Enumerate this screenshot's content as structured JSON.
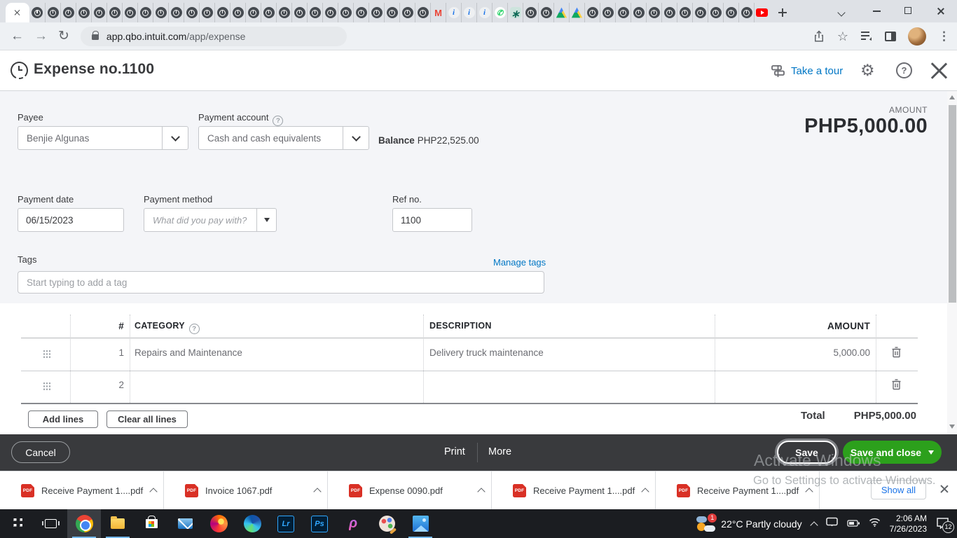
{
  "browser": {
    "url_host": "app.qbo.intuit.com",
    "url_path": "/app/expense",
    "favicons": [
      "qb",
      "qb",
      "qb",
      "qb",
      "qb",
      "qb",
      "qb",
      "qb",
      "qb",
      "qb",
      "qb",
      "qb",
      "qb",
      "qb",
      "qb",
      "qb",
      "qb",
      "qb",
      "qb",
      "qb",
      "qb",
      "qb",
      "qb",
      "qb",
      "qb",
      "qb",
      "gmail",
      "info",
      "info",
      "info",
      "whatsapp",
      "chatgpt",
      "qb",
      "qb",
      "drive",
      "drive",
      "qb",
      "qb",
      "qb",
      "qb",
      "qb",
      "qb",
      "qb",
      "qb",
      "qb",
      "qb",
      "qb",
      "youtube"
    ]
  },
  "header": {
    "title": "Expense no.1100",
    "tour_label": "Take a tour"
  },
  "form": {
    "payee": {
      "label": "Payee",
      "value": "Benjie Algunas"
    },
    "payment_account": {
      "label": "Payment account",
      "value": "Cash and cash equivalents"
    },
    "balance": {
      "label": "Balance",
      "value": "PHP22,525.00"
    },
    "amount": {
      "label": "AMOUNT",
      "value": "PHP5,000.00"
    },
    "payment_date": {
      "label": "Payment date",
      "value": "06/15/2023"
    },
    "payment_method": {
      "label": "Payment method",
      "placeholder": "What did you pay with?"
    },
    "ref_no": {
      "label": "Ref no.",
      "value": "1100"
    },
    "tags": {
      "label": "Tags",
      "manage_link": "Manage tags",
      "placeholder": "Start typing to add a tag"
    }
  },
  "table": {
    "headers": {
      "num": "#",
      "category": "CATEGORY",
      "description": "DESCRIPTION",
      "amount": "AMOUNT"
    },
    "rows": [
      {
        "num": "1",
        "category": "Repairs and Maintenance",
        "description": "Delivery truck maintenance",
        "amount": "5,000.00"
      },
      {
        "num": "2",
        "category": "",
        "description": "",
        "amount": ""
      }
    ],
    "add_lines_label": "Add lines",
    "clear_lines_label": "Clear all lines",
    "total_label": "Total",
    "total_value": "PHP5,000.00"
  },
  "footer": {
    "cancel": "Cancel",
    "print": "Print",
    "more": "More",
    "save": "Save",
    "save_and_close": "Save and close"
  },
  "downloads": {
    "items": [
      {
        "name": "Receive Payment 1....pdf"
      },
      {
        "name": "Invoice 1067.pdf"
      },
      {
        "name": "Expense 0090.pdf"
      },
      {
        "name": "Receive Payment 1....pdf"
      },
      {
        "name": "Receive Payment 1....pdf"
      }
    ],
    "show_all": "Show all"
  },
  "watermark": {
    "line1": "Activate Windows",
    "line2": "Go to Settings to activate Windows."
  },
  "taskbar": {
    "icons": [
      {
        "type": "start"
      },
      {
        "type": "taskview"
      },
      {
        "type": "chrome",
        "active": true,
        "open": true
      },
      {
        "type": "explorer",
        "open": true
      },
      {
        "type": "store"
      },
      {
        "type": "mail"
      },
      {
        "type": "firefox"
      },
      {
        "type": "edge"
      },
      {
        "type": "lightroom",
        "label": "Lr"
      },
      {
        "type": "photoshop",
        "label": "Ps"
      },
      {
        "type": "picsart",
        "label": "ρ"
      },
      {
        "type": "paint"
      },
      {
        "type": "photos",
        "open": true
      }
    ],
    "weather_badge": "1",
    "weather_text": "22°C Partly cloudy",
    "time": "2:06 AM",
    "date": "7/26/2023",
    "notif_badge": "12"
  },
  "colors": {
    "qbo_green": "#2ca01c",
    "qbo_link_blue": "#0077c5",
    "chrome_link_blue": "#1a73e8",
    "footer_dark": "#393a3d",
    "form_bg": "#f4f5f8"
  }
}
